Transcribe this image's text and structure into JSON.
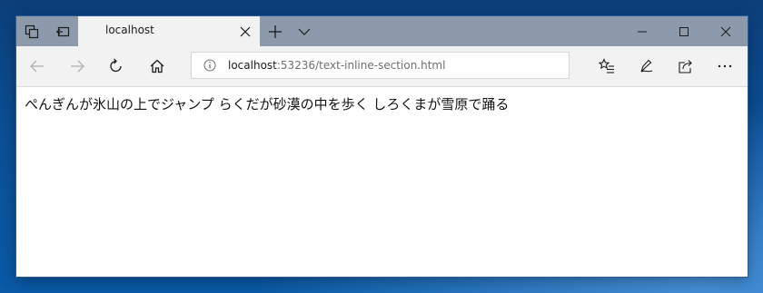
{
  "browser": {
    "tab": {
      "title": "localhost"
    },
    "address_bar": {
      "host": "localhost",
      "rest": ":53236/text-inline-section.html"
    },
    "titlebar_icons": [
      "tab-list-icon",
      "set-aside-tabs-icon",
      "new-tab-icon",
      "tab-preview-chevron-icon"
    ],
    "window_controls": [
      "minimize-icon",
      "maximize-icon",
      "close-icon"
    ],
    "nav_icons": [
      "back-arrow-icon",
      "forward-arrow-icon",
      "refresh-icon",
      "home-icon"
    ],
    "toolbar_icons": [
      "favorites-list-icon",
      "pen-icon",
      "share-icon",
      "more-icon"
    ]
  },
  "page": {
    "sentences": [
      "ぺんぎんが氷山の上でジャンプ",
      "らくだが砂漠の中を歩く",
      "しろくまが雪原で踊る"
    ]
  },
  "colors": {
    "titlebar": "#8c9aab",
    "toolbar": "#f2f2f2",
    "desktop": "#0b4f96"
  }
}
